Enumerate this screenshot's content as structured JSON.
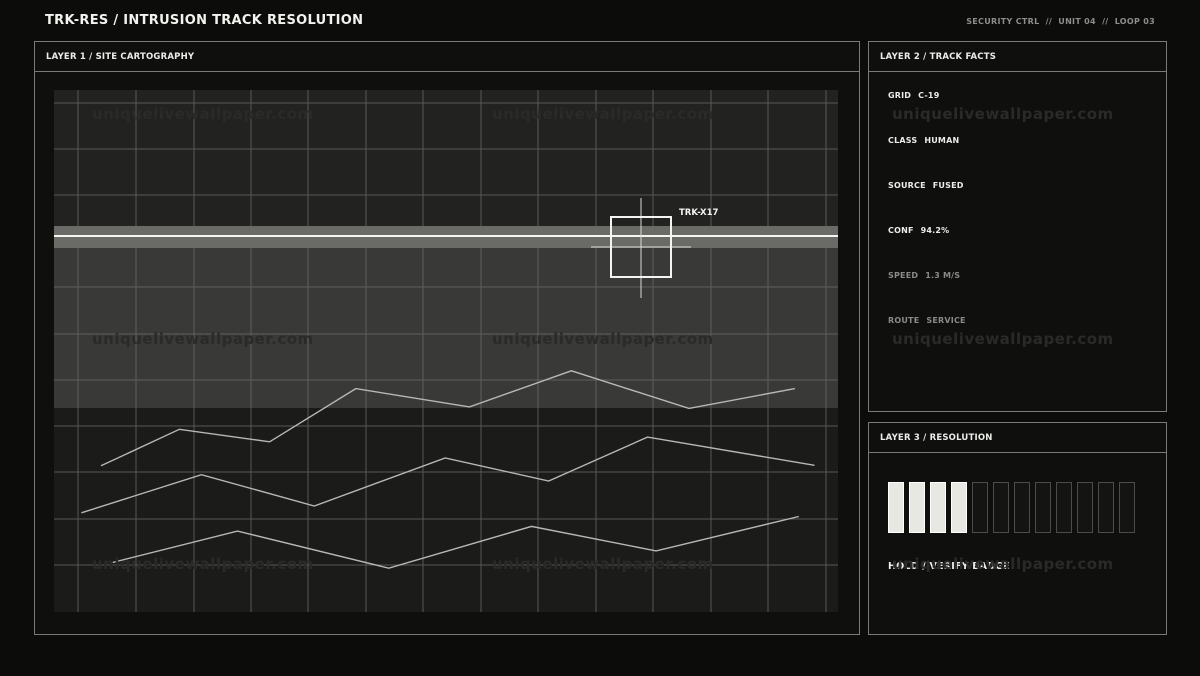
{
  "header": {
    "title": "TRK-RES / INTRUSION TRACK RESOLUTION",
    "meta": "SECURITY CTRL  //  UNIT 04  //  LOOP 03"
  },
  "map_panel": {
    "title": "LAYER 1 / SITE CARTOGRAPHY",
    "target_label": "TRK-X17",
    "traces": [
      [
        [
          0.06,
          0.72
        ],
        [
          0.16,
          0.65
        ],
        [
          0.275,
          0.674
        ],
        [
          0.385,
          0.572
        ],
        [
          0.53,
          0.607
        ],
        [
          0.66,
          0.538
        ],
        [
          0.81,
          0.61
        ],
        [
          0.945,
          0.572
        ]
      ],
      [
        [
          0.035,
          0.81
        ],
        [
          0.188,
          0.737
        ],
        [
          0.332,
          0.797
        ],
        [
          0.499,
          0.705
        ],
        [
          0.631,
          0.749
        ],
        [
          0.757,
          0.665
        ],
        [
          0.97,
          0.719
        ]
      ],
      [
        [
          0.075,
          0.905
        ],
        [
          0.234,
          0.845
        ],
        [
          0.427,
          0.916
        ],
        [
          0.609,
          0.836
        ],
        [
          0.768,
          0.883
        ],
        [
          0.95,
          0.817
        ]
      ]
    ]
  },
  "facts_panel": {
    "title": "LAYER 2 / TRACK FACTS",
    "rows": [
      {
        "key": "GRID",
        "value": "C-19",
        "dim": false
      },
      {
        "key": "CLASS",
        "value": "HUMAN",
        "dim": false
      },
      {
        "key": "SOURCE",
        "value": "FUSED",
        "dim": false
      },
      {
        "key": "CONF",
        "value": "94.2%",
        "dim": false
      },
      {
        "key": "SPEED",
        "value": "1.3 M/S",
        "dim": true
      },
      {
        "key": "ROUTE",
        "value": "SERVICE",
        "dim": true
      }
    ]
  },
  "resolution_panel": {
    "title": "LAYER 3 / RESOLUTION",
    "progress": {
      "filled": 4,
      "total": 12
    },
    "status": "HOLD / VERIFY BADGE"
  },
  "watermark": "uniquelivewallpaper.com",
  "colors": {
    "background": "#0c0d0b",
    "accent": "#e7e8e2",
    "border": "#7a7b77"
  }
}
